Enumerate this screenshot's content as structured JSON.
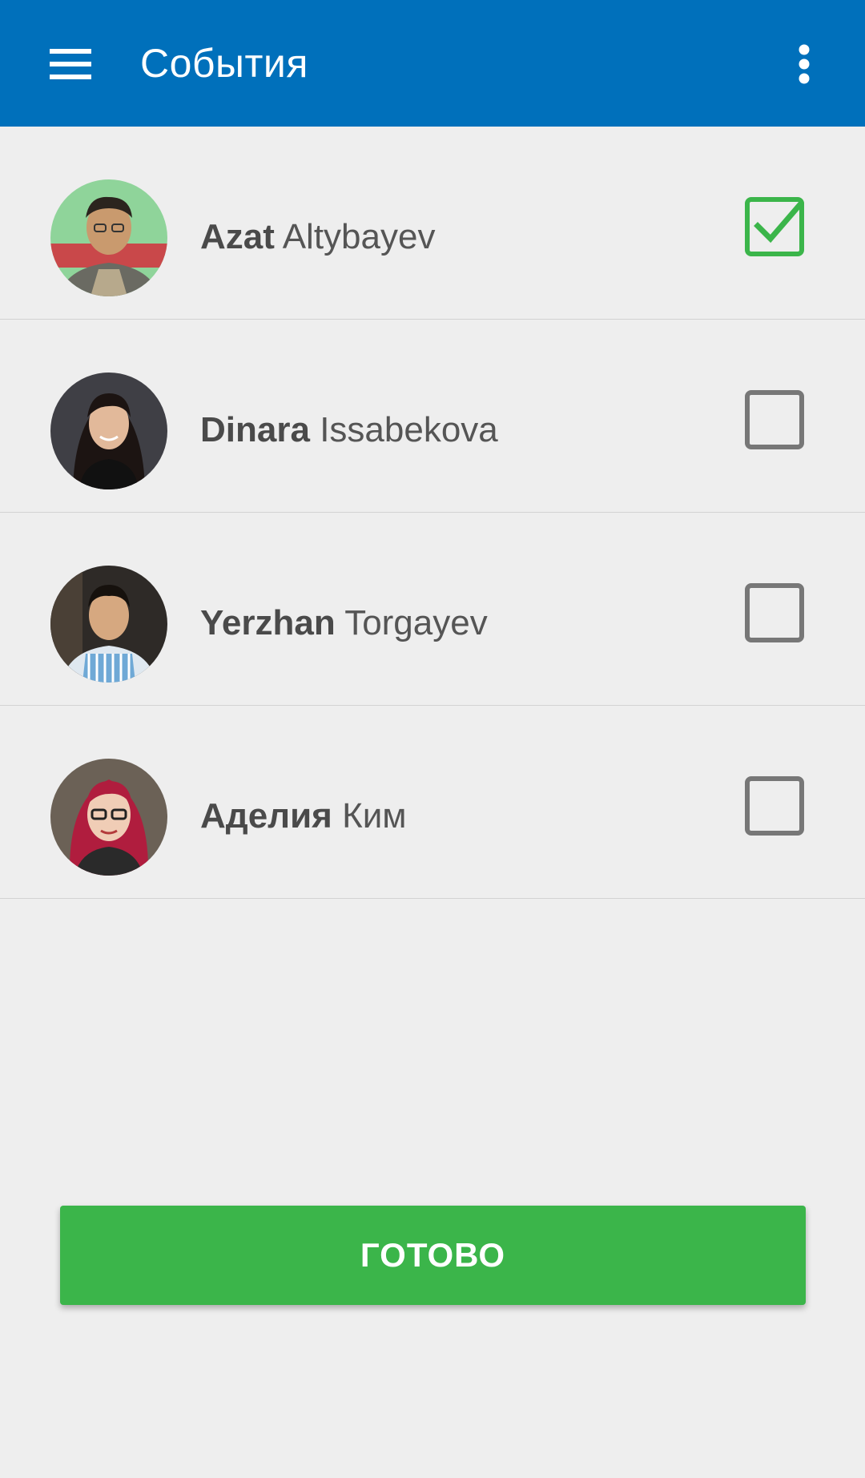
{
  "appbar": {
    "title": "События",
    "menu_icon": "hamburger-menu-icon",
    "overflow_icon": "more-vert-icon",
    "background": "#0070bb"
  },
  "people": [
    {
      "first": "Azat",
      "last": "Altybayev",
      "checked": true
    },
    {
      "first": "Dinara",
      "last": "Issabekova",
      "checked": false
    },
    {
      "first": "Yerzhan",
      "last": "Torgayev",
      "checked": false
    },
    {
      "first": "Аделия",
      "last": "Ким",
      "checked": false
    }
  ],
  "done_button": {
    "label": "ГОТОВО",
    "color": "#3bb54a"
  },
  "colors": {
    "checked": "#3bb54a",
    "unchecked": "#777777",
    "background": "#eeeeee"
  }
}
